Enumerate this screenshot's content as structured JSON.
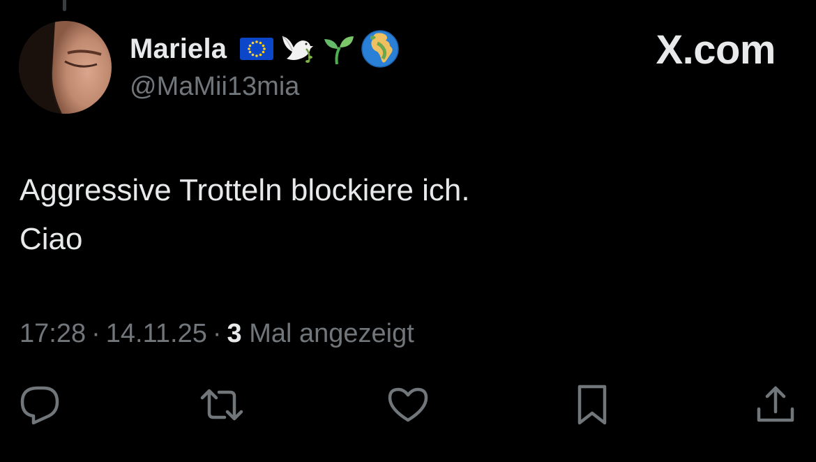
{
  "author": {
    "display_name": "Mariela",
    "handle": "@MaMii13mia",
    "name_emojis": [
      "eu-flag-emoji",
      "dove-emoji",
      "seedling-emoji",
      "globe-europe-africa-emoji"
    ]
  },
  "brand": {
    "label": "X.com"
  },
  "tweet": {
    "lines": [
      "Aggressive Trotteln blockiere ich.",
      "Ciao"
    ]
  },
  "meta": {
    "time": "17:28",
    "separator": "·",
    "date": "14.11.25",
    "views_count": "3",
    "views_label": "Mal angezeigt"
  },
  "actions": [
    {
      "name": "reply",
      "icon": "speech-bubble-icon"
    },
    {
      "name": "repost",
      "icon": "repost-arrows-icon"
    },
    {
      "name": "like",
      "icon": "heart-icon"
    },
    {
      "name": "bookmark",
      "icon": "bookmark-icon"
    },
    {
      "name": "share",
      "icon": "share-upload-icon"
    }
  ],
  "colors": {
    "background": "#000000",
    "primary_text": "#e7e9ea",
    "secondary_text": "#71767b",
    "eu_blue": "#0d47c9",
    "eu_gold": "#ffd21f"
  }
}
